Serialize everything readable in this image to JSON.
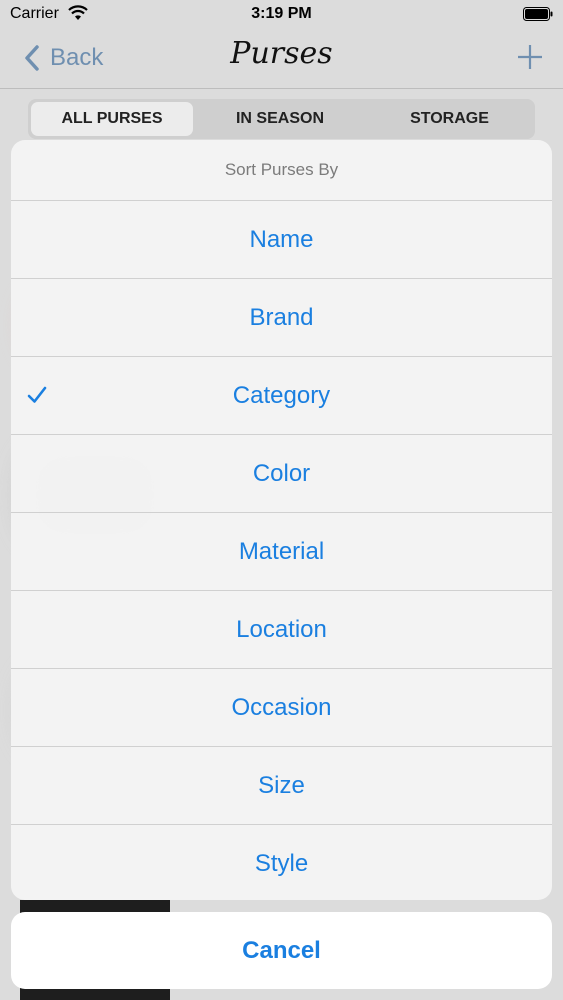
{
  "status_bar": {
    "carrier": "Carrier",
    "time": "3:19 PM"
  },
  "nav": {
    "back_label": "Back",
    "title": "Purses"
  },
  "segments": [
    "ALL PURSES",
    "IN SEASON",
    "STORAGE"
  ],
  "action_sheet": {
    "title": "Sort Purses By",
    "options": [
      "Name",
      "Brand",
      "Category",
      "Color",
      "Material",
      "Location",
      "Occasion",
      "Size",
      "Style"
    ],
    "selected": "Category",
    "cancel_label": "Cancel"
  },
  "colors": {
    "accent": "#1a7fe0",
    "back_tint": "#6f8fb0"
  },
  "icons": [
    "wifi-icon",
    "battery-icon",
    "chevron-left-icon",
    "plus-icon",
    "checkmark-icon"
  ]
}
